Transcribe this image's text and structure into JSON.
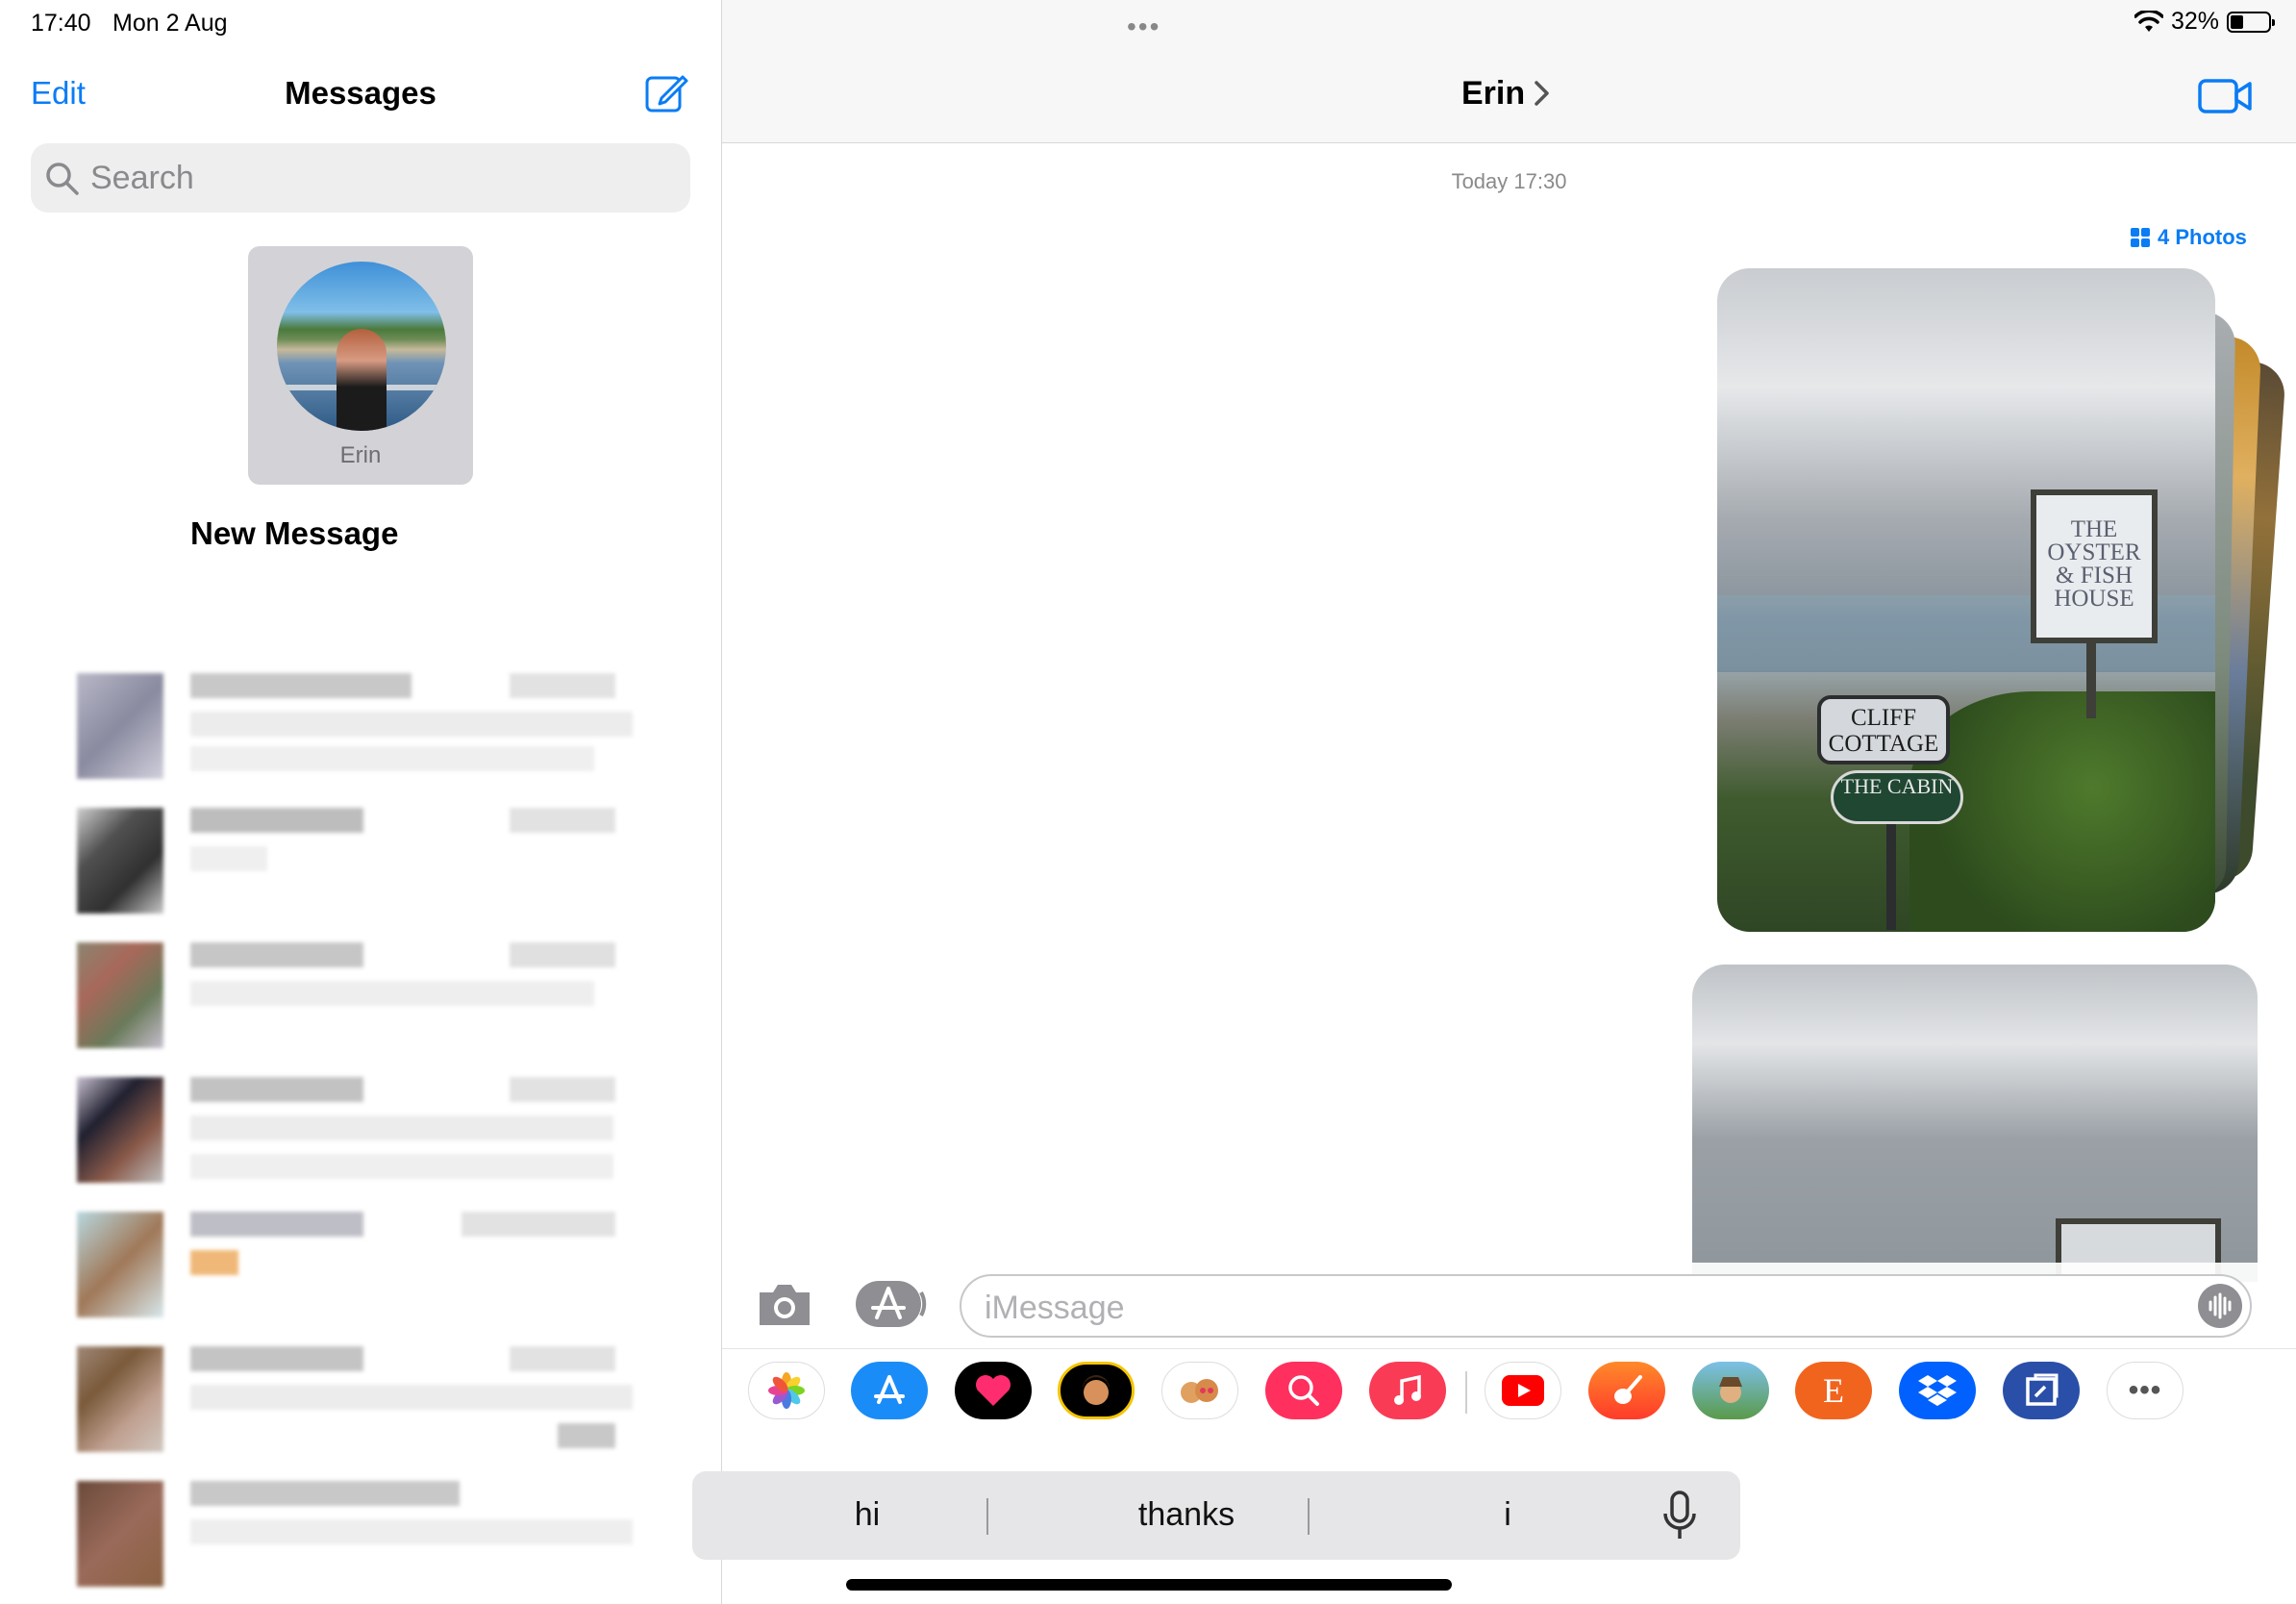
{
  "status": {
    "time": "17:40",
    "date": "Mon 2 Aug",
    "battery": "32%"
  },
  "sidebar": {
    "edit_label": "Edit",
    "title": "Messages",
    "search_placeholder": "Search",
    "pinned": [
      {
        "name": "Erin"
      }
    ],
    "new_message_label": "New Message"
  },
  "conversation": {
    "contact_name": "Erin",
    "timestamp": "Today 17:30",
    "photos_link": "4 Photos",
    "sign_oyster": "THE OYSTER & FISH HOUSE",
    "sign_cliff": "CLIFF COTTAGE",
    "sign_cabin": "THE CABIN"
  },
  "composer": {
    "placeholder": "iMessage"
  },
  "app_drawer": {
    "apps": [
      "Photos",
      "App Store",
      "Digital Touch",
      "Memoji",
      "Memoji Stickers",
      "Images",
      "Music",
      "YouTube",
      "GarageBand",
      "Game",
      "Etsy",
      "Dropbox",
      "Screen Time",
      "More"
    ],
    "etsy_letter": "E",
    "more_glyph": "•••"
  },
  "keyboard": {
    "suggestions": [
      "hi",
      "thanks",
      "i"
    ]
  }
}
